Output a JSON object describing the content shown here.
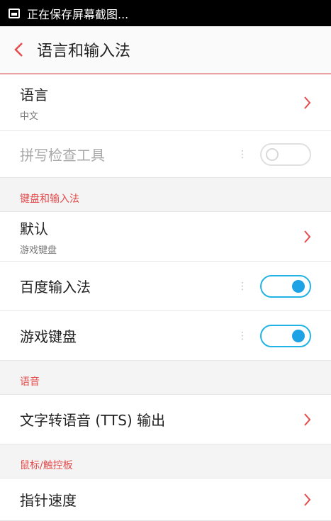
{
  "status_bar": {
    "text": "正在保存屏幕截图..."
  },
  "header": {
    "title": "语言和输入法"
  },
  "language": {
    "title": "语言",
    "value": "中文"
  },
  "spell_check": {
    "title": "拼写检查工具",
    "enabled": false
  },
  "keyboard_section": {
    "header": "键盘和输入法",
    "default": {
      "title": "默认",
      "value": "游戏键盘"
    },
    "baidu": {
      "title": "百度输入法",
      "enabled": true
    },
    "game_keyboard": {
      "title": "游戏键盘",
      "enabled": true
    }
  },
  "voice_section": {
    "header": "语音",
    "tts": {
      "title": "文字转语音 (TTS) 输出"
    }
  },
  "pointer_section": {
    "header": "鼠标/触控板",
    "pointer_speed": {
      "title": "指针速度"
    }
  },
  "colors": {
    "accent_red": "#e54b4b",
    "toggle_blue": "#1ea2e6"
  },
  "icons": {
    "back": "chevron-left-icon",
    "arrow": "chevron-right-icon",
    "screenshot": "screenshot-icon"
  }
}
